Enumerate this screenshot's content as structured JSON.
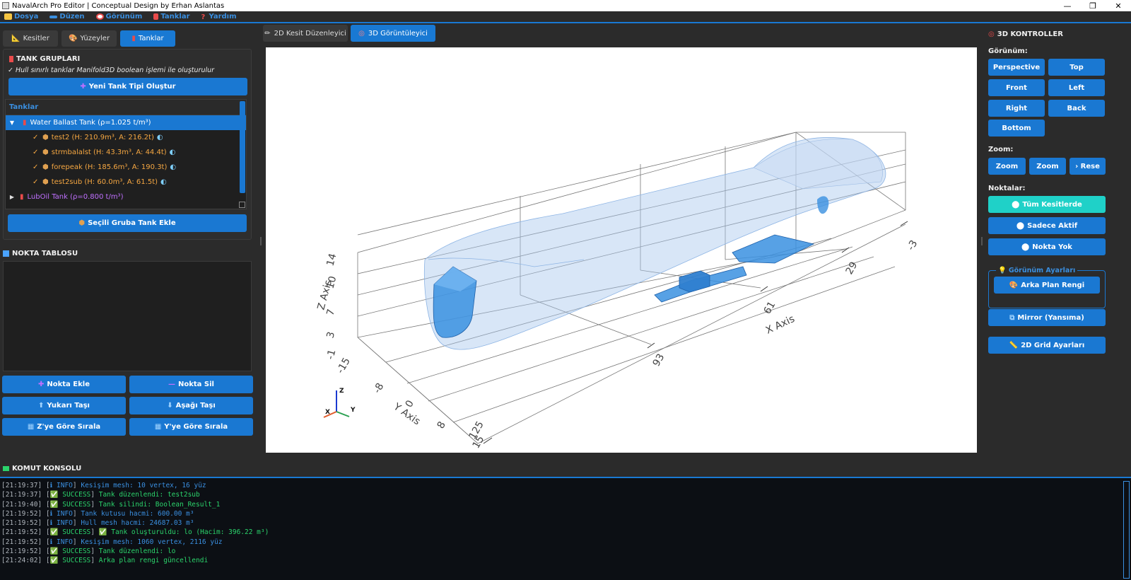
{
  "window": {
    "title": "NavalArch Pro Editor | Conceptual Design by Erhan Aslantas",
    "controls": [
      "—",
      "❐",
      "✕"
    ]
  },
  "menu": [
    {
      "label": "Dosya",
      "color": "#f5c542"
    },
    {
      "label": "Düzen",
      "color": "#3a8fe0"
    },
    {
      "label": "Görünüm",
      "color": "#e94b4b"
    },
    {
      "label": "Tanklar",
      "color": "#e94b4b"
    },
    {
      "label": "Yardım",
      "color": "#e94b4b"
    }
  ],
  "left_tabs": [
    {
      "label": "Kesitler",
      "icon": "ruler-icon"
    },
    {
      "label": "Yüzeyler",
      "icon": "palette-icon"
    },
    {
      "label": "Tanklar",
      "icon": "tank-icon",
      "active": true
    }
  ],
  "tank_groups": {
    "title": "TANK GRUPLARI",
    "note": "✓ Hull sınırlı tanklar Manifold3D boolean işlemi ile oluşturulur",
    "new_button": "Yeni Tank Tipi Oluştur",
    "tree_header": "Tanklar",
    "groups": [
      {
        "label": "Water Ballast Tank (ρ=1.025 t/m³)",
        "expanded": true,
        "selected": true,
        "children": [
          {
            "label": "test2 (H: 210.9m³, A: 216.2t)"
          },
          {
            "label": "strmbalalst (H: 43.3m³, A: 44.4t)"
          },
          {
            "label": "forepeak (H: 185.6m³, A: 190.3t)"
          },
          {
            "label": "test2sub (H: 60.0m³, A: 61.5t)"
          }
        ]
      },
      {
        "label": "LubOil Tank (ρ=0.800 t/m³)",
        "expanded": false,
        "selected": false,
        "children": []
      }
    ],
    "add_button": "Seçili Gruba Tank Ekle"
  },
  "nokta_tablosu": {
    "title": "NOKTA TABLOSU",
    "buttons": [
      {
        "label": "Nokta Ekle",
        "icon": "+",
        "icon_color": "#c070ff"
      },
      {
        "label": "Nokta Sil",
        "icon": "—",
        "icon_color": "#c070ff"
      },
      {
        "label": "Yukarı Taşı",
        "icon": "⬆",
        "icon_color": "#9fd3ff"
      },
      {
        "label": "Aşağı Taşı",
        "icon": "⬇",
        "icon_color": "#9fd3ff"
      },
      {
        "label": "Z'ye Göre Sırala",
        "icon": "▦",
        "icon_color": "#9fd3ff"
      },
      {
        "label": "Y'ye Göre Sırala",
        "icon": "▦",
        "icon_color": "#9fd3ff"
      }
    ]
  },
  "center_tabs": [
    {
      "label": "2D Kesit Düzenleyici",
      "icon": "pencil-icon"
    },
    {
      "label": "3D Görüntüleyici",
      "icon": "target-icon",
      "active": true
    }
  ],
  "viewport": {
    "x_axis_label": "X Axis",
    "y_axis_label": "Y Axis",
    "z_axis_label": "Z Axis",
    "x_ticks": [
      "125",
      "93",
      "61",
      "29",
      "-3"
    ],
    "y_ticks": [
      "-15",
      "-8",
      "0",
      "8",
      "15"
    ],
    "z_ticks": [
      "-1",
      "3",
      "7",
      "10",
      "14"
    ],
    "triad": {
      "z": "Z",
      "x": "X",
      "y": "Y"
    },
    "hull_color": "#a8c8ee",
    "tank_color": "#3a90e0"
  },
  "controls_3d": {
    "title": "3D KONTROLLER",
    "view_label": "Görünüm:",
    "views": [
      "Perspective",
      "Top",
      "Front",
      "Left",
      "Right",
      "Back",
      "Bottom"
    ],
    "zoom_label": "Zoom:",
    "zoom_buttons": [
      "Zoom",
      "Zoom",
      "› Rese"
    ],
    "points_label": "Noktalar:",
    "points_buttons": [
      {
        "label": "Tüm Kesitlerde",
        "active": true
      },
      {
        "label": "Sadece Aktif",
        "active": false
      },
      {
        "label": "Nokta Yok",
        "active": false
      }
    ],
    "view_settings_legend": "Görünüm Ayarları",
    "bg_color_button": "Arka Plan Rengi",
    "mirror_button": "Mirror (Yansıma)",
    "grid_button": "2D Grid Ayarları"
  },
  "console": {
    "title": "KOMUT KONSOLU",
    "lines": [
      {
        "time": "[21:19:37]",
        "level": "INFO",
        "msg": "Kesişim mesh: 10 vertex, 16 yüz"
      },
      {
        "time": "[21:19:37]",
        "level": "SUCCESS",
        "msg": "Tank düzenlendi: test2sub"
      },
      {
        "time": "[21:19:40]",
        "level": "SUCCESS",
        "msg": "Tank silindi: Boolean_Result_1"
      },
      {
        "time": "[21:19:52]",
        "level": "INFO",
        "msg": "Tank kutusu hacmi: 600.00 m³"
      },
      {
        "time": "[21:19:52]",
        "level": "INFO",
        "msg": "Hull mesh hacmi: 24687.03 m³"
      },
      {
        "time": "[21:19:52]",
        "level": "SUCCESS",
        "msg": "✅ Tank oluşturuldu: lo (Hacim: 396.22 m³)"
      },
      {
        "time": "[21:19:52]",
        "level": "INFO",
        "msg": "Kesişim mesh: 1060 vertex, 2116 yüz"
      },
      {
        "time": "[21:19:52]",
        "level": "SUCCESS",
        "msg": "Tank düzenlendi: lo"
      },
      {
        "time": "[21:24:02]",
        "level": "SUCCESS",
        "msg": "Arka plan rengi güncellendi"
      }
    ]
  }
}
